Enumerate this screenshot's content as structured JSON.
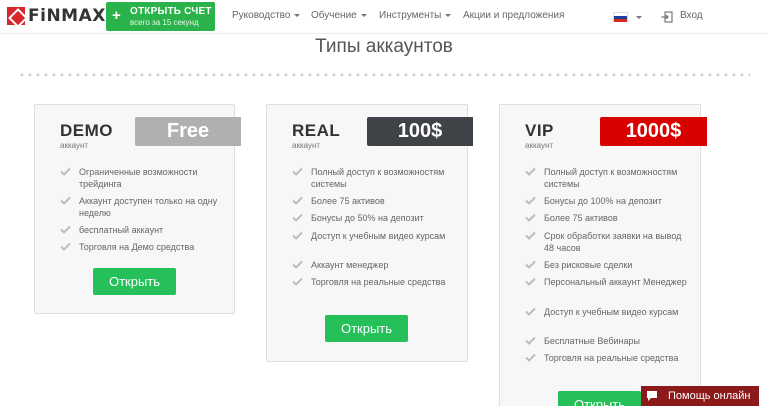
{
  "header": {
    "logo_text": "FiNMAX",
    "open_account": {
      "icon": "plus-icon",
      "plus": "+",
      "label": "ОТКРЫТЬ СЧЕТ",
      "sublabel": "всего за 15 секунд"
    },
    "nav": [
      {
        "label": "Руководство"
      },
      {
        "label": "Обучение"
      },
      {
        "label": "Инструменты"
      },
      {
        "label": "Акции и предложения"
      }
    ],
    "login_label": "Вход",
    "colors": {
      "brand_red": "#d9262b",
      "green": "#29b34a"
    }
  },
  "section_title": "Типы аккаунтов",
  "cards": [
    {
      "name": "DEMO",
      "sub": "аккаунт",
      "price": "Free",
      "price_color": "#b0b0b0",
      "features": [
        "Ограниченные возможности трейдинга",
        "Аккаунт доступен только на одну неделю",
        "бесплатный аккаунт",
        "Торговля на Демо средства"
      ],
      "button": "Открыть"
    },
    {
      "name": "REAL",
      "sub": "аккаунт",
      "price": "100$",
      "price_color": "#3f4247",
      "features": [
        "Полный доступ к возможностям системы",
        "Более 75 активов",
        "Бонусы до 50% на депозит",
        "Доступ к учебным видео курсам",
        "Аккаунт менеджер",
        "Торговля на реальные средства"
      ],
      "button": "Открыть"
    },
    {
      "name": "VIP",
      "sub": "аккаунт",
      "price": "1000$",
      "price_color": "#d90000",
      "features": [
        "Полный доступ к возможностям системы",
        "Бонусы до 100% на депозит",
        "Более 75 активов",
        "Срок обработки заявки на вывод 48 часов",
        "Без рисковые сделки",
        "Персональный аккаунт Менеджер",
        "Доступ к учебным видео курсам",
        "Бесплатные Вебинары",
        "Торговля на реальные средства"
      ],
      "button": "Открыть"
    }
  ],
  "help": {
    "label": "Помощь онлайн",
    "icon": "chat-icon",
    "color": "#8c1a1a"
  }
}
